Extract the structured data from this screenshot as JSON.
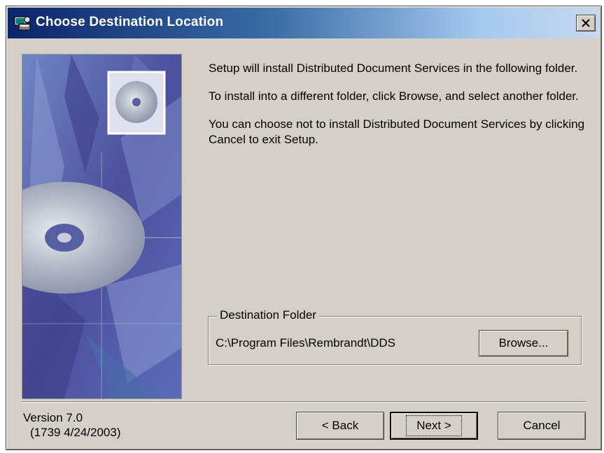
{
  "window": {
    "title": "Choose Destination Location",
    "title_icon": "setup-icon",
    "close_icon": "close-icon"
  },
  "info": {
    "paragraph1": "Setup will install Distributed Document Services in the following folder.",
    "paragraph2": "To install into a different folder, click Browse, and select another folder.",
    "paragraph3": "You can choose not to install Distributed Document Services by clicking Cancel to exit Setup."
  },
  "destination": {
    "legend": "Destination Folder",
    "path": "C:\\Program Files\\Rembrandt\\DDS",
    "browse_label": "Browse..."
  },
  "footer": {
    "version": "Version 7.0",
    "build": "(1739  4/24/2003)"
  },
  "buttons": {
    "back_label": "< Back",
    "next_label": "Next >",
    "cancel_label": "Cancel"
  },
  "colors": {
    "dialog_bg": "#d4d0c8",
    "title_start": "#0a246a",
    "title_end": "#a6caf0",
    "art_base": "#5a5fa8"
  }
}
